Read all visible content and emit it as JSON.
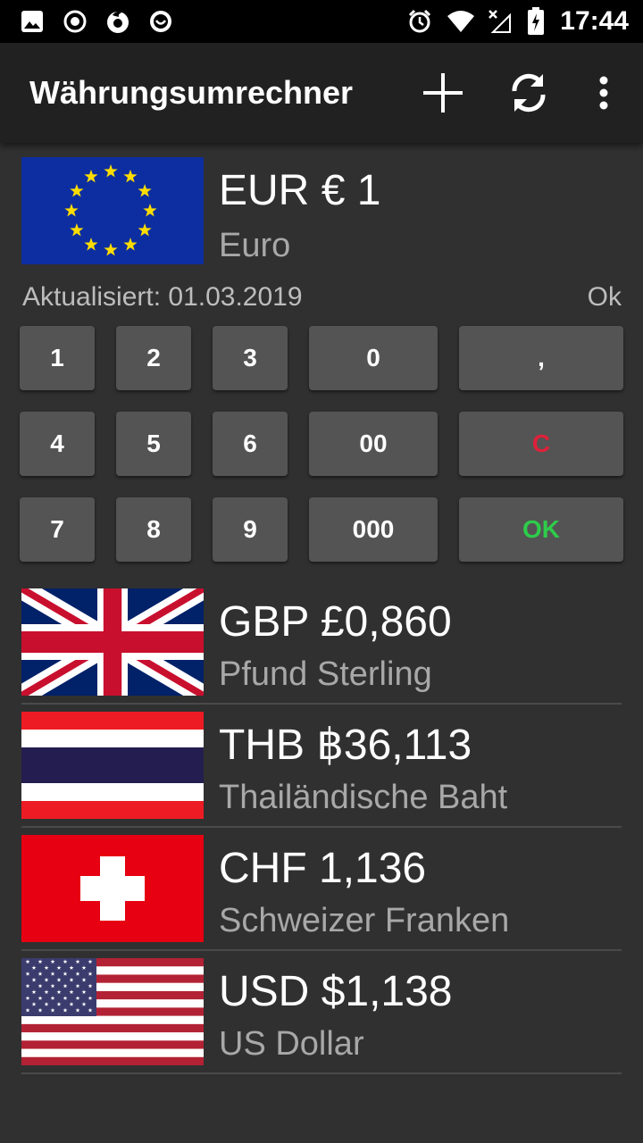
{
  "status_bar": {
    "time": "17:44",
    "icons": [
      "image-icon",
      "record-icon",
      "firefox-icon",
      "smile-icon",
      "alarm-icon",
      "wifi-icon",
      "no-signal-icon",
      "battery-charging-icon"
    ]
  },
  "app_bar": {
    "title": "Währungsumrechner",
    "actions": [
      "add-icon",
      "refresh-icon",
      "more-vert-icon"
    ]
  },
  "base_currency": {
    "code": "EUR",
    "amount_display": "€ 1",
    "name": "Euro",
    "flag": "eu-flag"
  },
  "update_info": {
    "updated_text": "Aktualisiert: 01.03.2019",
    "status_text": "Ok"
  },
  "keypad": {
    "keys": [
      "1",
      "2",
      "3",
      "0",
      ",",
      "4",
      "5",
      "6",
      "00",
      "C",
      "7",
      "8",
      "9",
      "000",
      "OK"
    ],
    "colors": {
      "clear": "#e0203a",
      "ok": "#2ecc4a",
      "key_bg": "#545454"
    }
  },
  "currencies": [
    {
      "code": "GBP",
      "amount": "£0,860",
      "name": "Pfund Sterling",
      "flag": "uk-flag"
    },
    {
      "code": "THB",
      "amount": "฿36,113",
      "name": "Thailändische Baht",
      "flag": "thailand-flag"
    },
    {
      "code": "CHF",
      "amount": "1,136",
      "name": "Schweizer Franken",
      "flag": "switzerland-flag"
    },
    {
      "code": "USD",
      "amount": "$1,138",
      "name": "US Dollar",
      "flag": "usa-flag"
    }
  ]
}
